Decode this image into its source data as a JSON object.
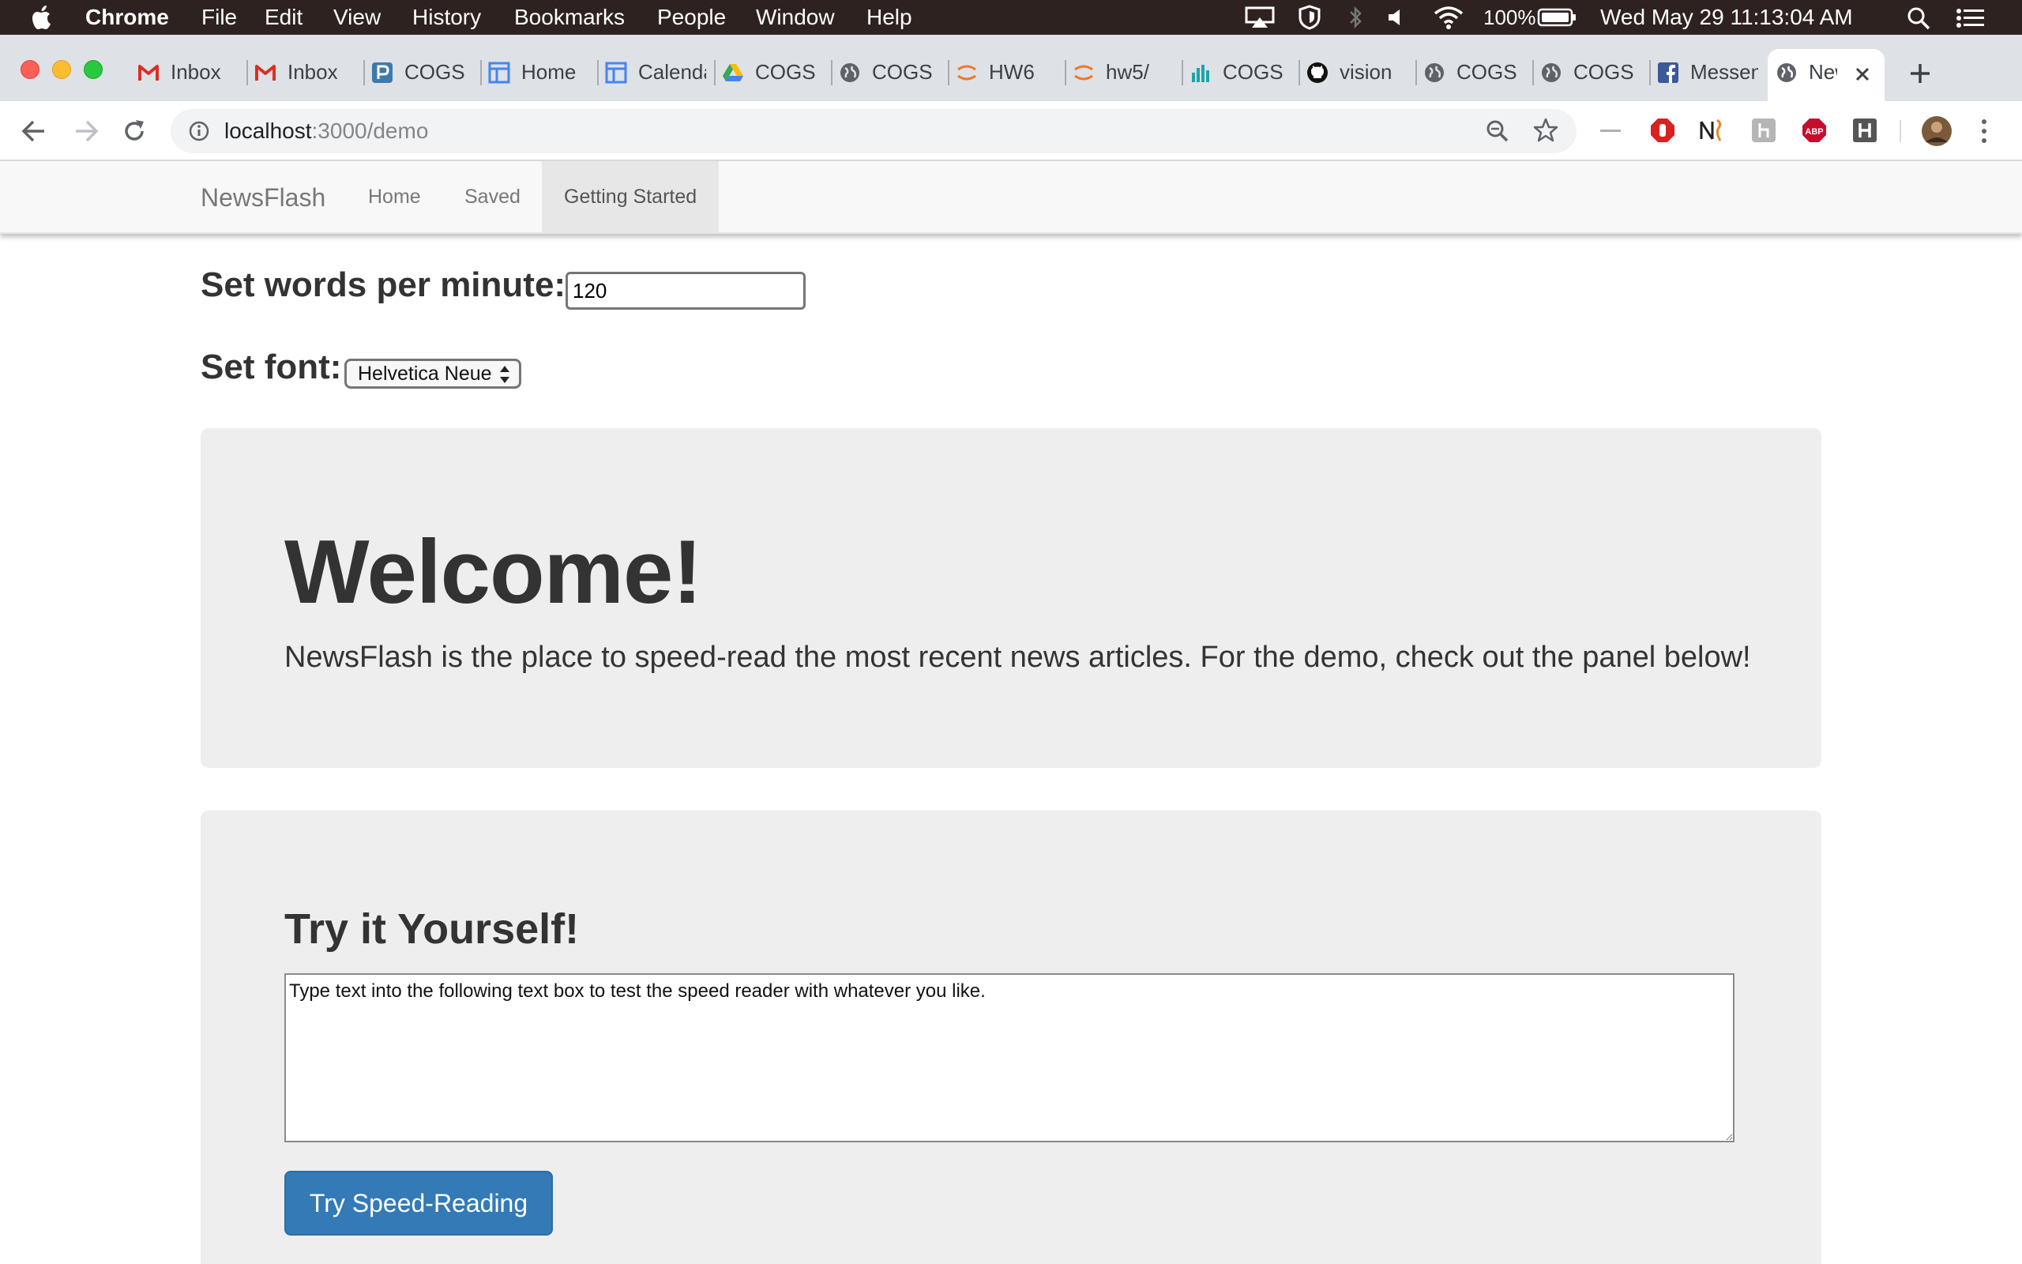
{
  "menubar": {
    "app_name": "Chrome",
    "items": [
      "File",
      "Edit",
      "View",
      "History",
      "Bookmarks",
      "People",
      "Window",
      "Help"
    ],
    "battery": "100%",
    "datetime": "Wed May 29  11:13:04 AM"
  },
  "tabs": [
    {
      "label": "Inbox",
      "icon": "gmail-icon"
    },
    {
      "label": "Inbox",
      "icon": "gmail-icon"
    },
    {
      "label": "COGS",
      "icon": "piazza-icon"
    },
    {
      "label": "Home",
      "icon": "calendar-icon"
    },
    {
      "label": "Calendar",
      "icon": "calendar-icon"
    },
    {
      "label": "COGS",
      "icon": "google-drive-icon"
    },
    {
      "label": "COGS",
      "icon": "globe-icon"
    },
    {
      "label": "HW6",
      "icon": "jupyter-icon"
    },
    {
      "label": "hw5/",
      "icon": "jupyter-icon"
    },
    {
      "label": "COGS",
      "icon": "bar-chart-icon"
    },
    {
      "label": "vision",
      "icon": "github-icon"
    },
    {
      "label": "COGS",
      "icon": "globe-icon"
    },
    {
      "label": "COGS",
      "icon": "globe-icon"
    },
    {
      "label": "Messenger",
      "icon": "facebook-icon"
    },
    {
      "label": "NewsFlash",
      "icon": "globe-icon",
      "active": true
    }
  ],
  "browser": {
    "url_host": "localhost",
    "url_rest": ":3000/demo"
  },
  "nav": {
    "brand": "NewsFlash",
    "links": [
      "Home",
      "Saved",
      "Getting Started"
    ],
    "active_link": "Getting Started"
  },
  "settings": {
    "wpm_label": "Set words per minute:",
    "wpm_value": "120",
    "font_label": "Set font:",
    "font_value": "Helvetica Neue"
  },
  "welcome": {
    "title": "Welcome!",
    "text": "NewsFlash is the place to speed-read the most recent news articles. For the demo, check out the panel below!"
  },
  "try": {
    "title": "Try it Yourself!",
    "textarea_value": "Type text into the following text box to test the speed reader with whatever you like.",
    "button_label": "Try Speed-Reading"
  },
  "colors": {
    "menubar_bg": "#2e2220",
    "tabstrip_bg": "#dee1e6",
    "jumbotron_bg": "#eeeeee",
    "primary_button": "#337ab7"
  }
}
